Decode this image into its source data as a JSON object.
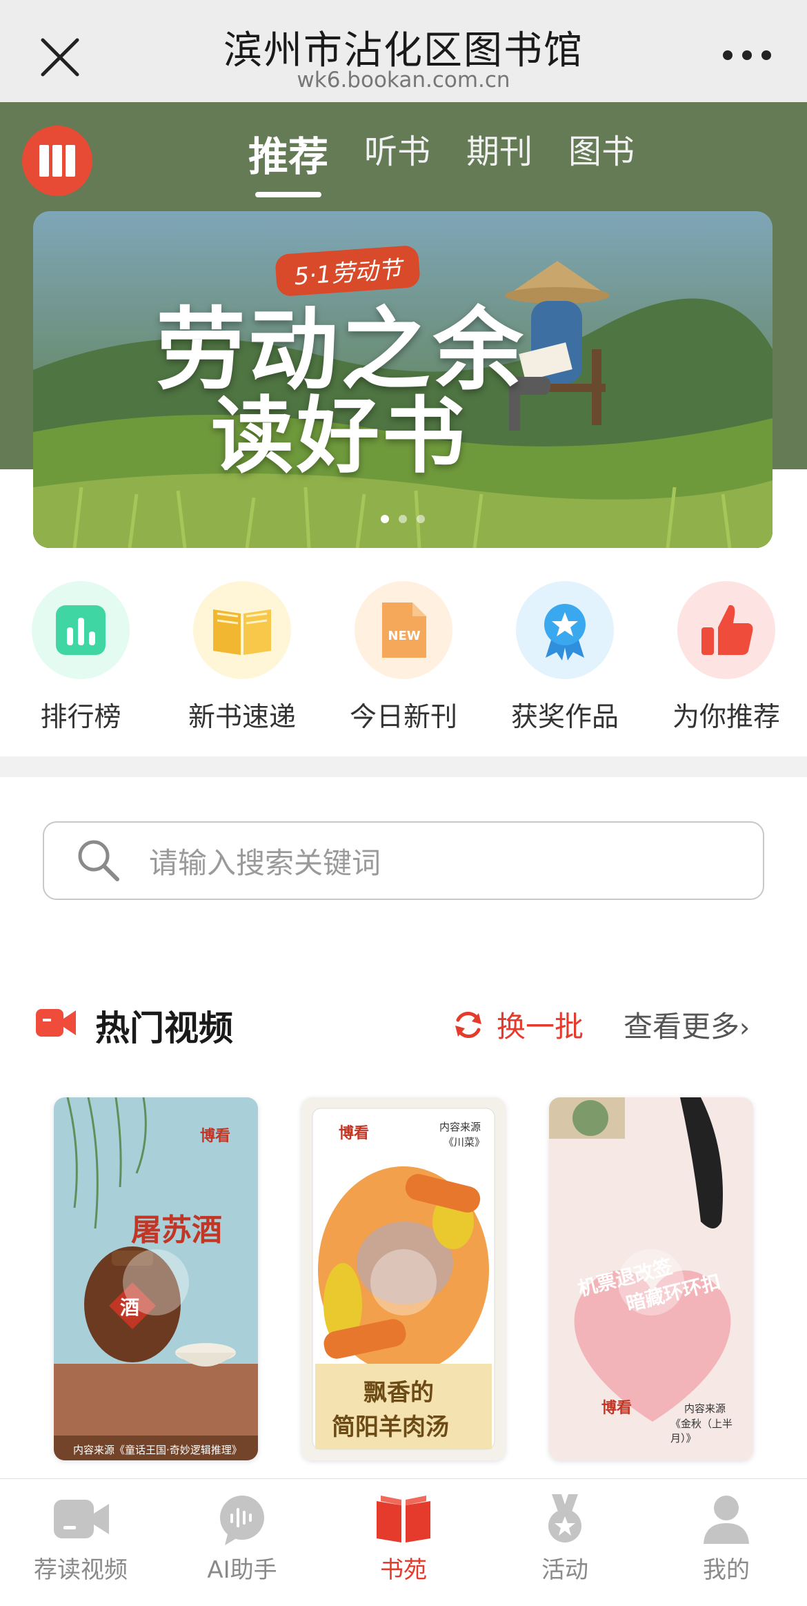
{
  "topbar": {
    "title": "滨州市沾化区图书馆",
    "url": "wk6.bookan.com.cn",
    "close_icon": "close-icon",
    "more_icon": "more-dots-icon"
  },
  "tabs": [
    {
      "label": "推荐",
      "active": true
    },
    {
      "label": "听书",
      "active": false
    },
    {
      "label": "期刊",
      "active": false
    },
    {
      "label": "图书",
      "active": false
    }
  ],
  "banner": {
    "badge": "5·1劳动节",
    "line1": "劳动之余",
    "line2": "读好书",
    "slide_count": 3,
    "active_slide": 1
  },
  "quick_links": [
    {
      "label": "排行榜",
      "icon": "ranking-chart-icon",
      "color": "#3fd6a4"
    },
    {
      "label": "新书速递",
      "icon": "open-book-icon",
      "color": "#f2b730"
    },
    {
      "label": "今日新刊",
      "icon": "new-document-icon",
      "color": "#f5a85a"
    },
    {
      "label": "获奖作品",
      "icon": "award-ribbon-icon",
      "color": "#3aa8ef"
    },
    {
      "label": "为你推荐",
      "icon": "thumbs-up-icon",
      "color": "#ef4c3c"
    }
  ],
  "search": {
    "placeholder": "请输入搜索关键词"
  },
  "hot_videos": {
    "title": "热门视频",
    "refresh_label": "换一批",
    "more_label": "查看更多",
    "items": [
      {
        "title": "屠苏酒",
        "brand": "博看",
        "jar_label": "酒",
        "source": "内容来源《童话王国·奇妙逻辑推理》"
      },
      {
        "title_line1": "飘香的",
        "title_line2": "简阳羊肉汤",
        "brand": "博看",
        "source_label": "内容来源",
        "source_name": "《川菜》"
      },
      {
        "title_line1": "机票退改签",
        "title_line2": "暗藏环环扣",
        "brand": "博看",
        "source_label": "内容来源",
        "source_name": "《金秋（上半月）》"
      }
    ]
  },
  "bottom_nav": [
    {
      "label": "荐读视频",
      "icon": "video-camera-icon",
      "active": false
    },
    {
      "label": "AI助手",
      "icon": "ai-assistant-icon",
      "active": false
    },
    {
      "label": "书苑",
      "icon": "book-icon",
      "active": true
    },
    {
      "label": "活动",
      "icon": "medal-icon",
      "active": false
    },
    {
      "label": "我的",
      "icon": "user-icon",
      "active": false
    }
  ],
  "colors": {
    "accent": "#e43b2c",
    "hero_green": "#647b56"
  }
}
